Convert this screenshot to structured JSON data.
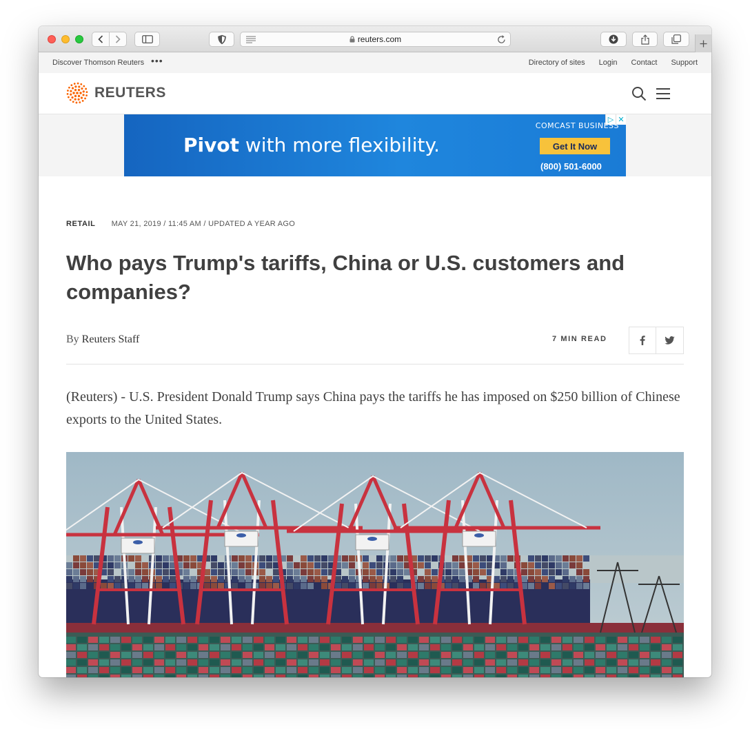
{
  "browser": {
    "url": "reuters.com",
    "icons": [
      "back-icon",
      "forward-icon",
      "sidebar-icon",
      "privacy-shield-icon",
      "reader-icon",
      "lock-icon",
      "reload-icon",
      "download-icon",
      "share-icon",
      "tabs-icon",
      "plus-icon"
    ]
  },
  "topstrip": {
    "discover": "Discover Thomson Reuters",
    "more": "•••",
    "links": [
      "Directory of sites",
      "Login",
      "Contact",
      "Support"
    ]
  },
  "header": {
    "brand": "REUTERS",
    "icons": [
      "search-icon",
      "menu-icon"
    ]
  },
  "ad": {
    "headline_bold": "Pivot",
    "headline_rest": " with more flexibility.",
    "brand": "COMCAST BUSINESS",
    "cta": "Get It Now",
    "phone": "(800) 501-6000",
    "choices": [
      "▷",
      "✕"
    ],
    "colors": {
      "background": "#1a7bd6",
      "cta": "#f7c23b"
    }
  },
  "article": {
    "section": "RETAIL",
    "date": "MAY 21, 2019 / 11:45 AM / UPDATED A YEAR AGO",
    "headline": "Who pays Trump's tariffs, China or U.S. customers and companies?",
    "byline_prefix": "By ",
    "author": "Reuters Staff",
    "read_time": "7 MIN READ",
    "share": [
      "facebook-icon",
      "twitter-icon"
    ],
    "lede": "(Reuters) - U.S. President Donald Trump says China pays the tariffs he has imposed on $250 billion of Chinese exports to the United States."
  }
}
